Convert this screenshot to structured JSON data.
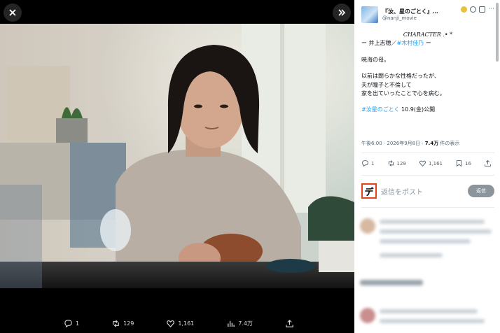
{
  "viewer": {
    "close_icon": "close-icon",
    "expand_icon": "double-chevron-right-icon",
    "actions": {
      "reply_count": "1",
      "repost_count": "129",
      "like_count": "1,161",
      "views_count": "7.4万"
    },
    "photo_alt": "Woman with shoulder-length black hair in a beige cardigan sitting at a dining table"
  },
  "post": {
    "author_name": "『汝、星のごとく』…",
    "author_handle": "@nanji_movie",
    "line_character": "CHARACTER .• *",
    "line_cast_prefix": "ー 井上志穂／",
    "line_cast_hash": "#木村佳乃",
    "line_cast_suffix": " ー",
    "line_role": "暁海の母。",
    "line_desc1": "以前は朗らかな性格だったが、",
    "line_desc2": "夫が瞳子と不倫して",
    "line_desc3": "家を出ていったことで心を病む。",
    "line_promo_hash": "#汝星のごとく",
    "line_promo_rest": " 10.9(金)公開",
    "timestamp": "午後6:00 · 2026年9月8日 · ",
    "views_number": "7.4万",
    "views_suffix": " 件の表示",
    "reply_count": "1",
    "repost_count": "129",
    "like_count": "1,161",
    "bookmark_count": "16"
  },
  "reply": {
    "avatar_glyph": "デ",
    "placeholder": "返信をポスト",
    "button_label": "返信"
  }
}
